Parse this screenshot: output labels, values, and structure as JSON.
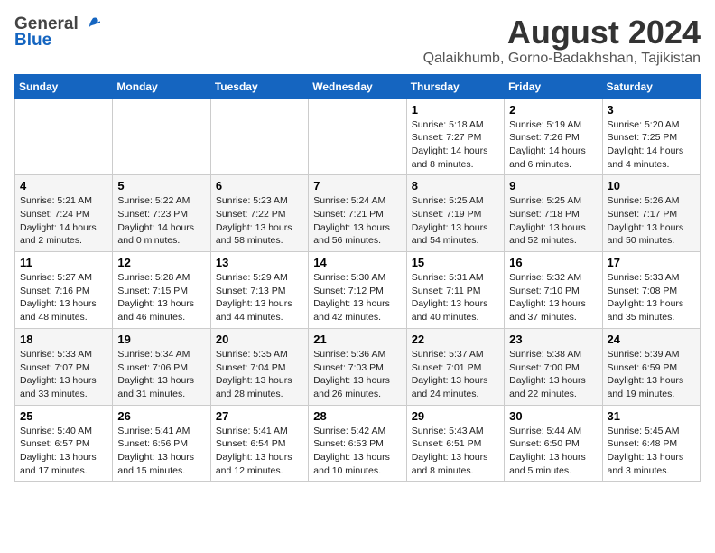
{
  "logo": {
    "general": "General",
    "blue": "Blue"
  },
  "title": "August 2024",
  "subtitle": "Qalaikhumb, Gorno-Badakhshan, Tajikistan",
  "days_of_week": [
    "Sunday",
    "Monday",
    "Tuesday",
    "Wednesday",
    "Thursday",
    "Friday",
    "Saturday"
  ],
  "weeks": [
    [
      {
        "day": "",
        "info": ""
      },
      {
        "day": "",
        "info": ""
      },
      {
        "day": "",
        "info": ""
      },
      {
        "day": "",
        "info": ""
      },
      {
        "day": "1",
        "info": "Sunrise: 5:18 AM\nSunset: 7:27 PM\nDaylight: 14 hours\nand 8 minutes."
      },
      {
        "day": "2",
        "info": "Sunrise: 5:19 AM\nSunset: 7:26 PM\nDaylight: 14 hours\nand 6 minutes."
      },
      {
        "day": "3",
        "info": "Sunrise: 5:20 AM\nSunset: 7:25 PM\nDaylight: 14 hours\nand 4 minutes."
      }
    ],
    [
      {
        "day": "4",
        "info": "Sunrise: 5:21 AM\nSunset: 7:24 PM\nDaylight: 14 hours\nand 2 minutes."
      },
      {
        "day": "5",
        "info": "Sunrise: 5:22 AM\nSunset: 7:23 PM\nDaylight: 14 hours\nand 0 minutes."
      },
      {
        "day": "6",
        "info": "Sunrise: 5:23 AM\nSunset: 7:22 PM\nDaylight: 13 hours\nand 58 minutes."
      },
      {
        "day": "7",
        "info": "Sunrise: 5:24 AM\nSunset: 7:21 PM\nDaylight: 13 hours\nand 56 minutes."
      },
      {
        "day": "8",
        "info": "Sunrise: 5:25 AM\nSunset: 7:19 PM\nDaylight: 13 hours\nand 54 minutes."
      },
      {
        "day": "9",
        "info": "Sunrise: 5:25 AM\nSunset: 7:18 PM\nDaylight: 13 hours\nand 52 minutes."
      },
      {
        "day": "10",
        "info": "Sunrise: 5:26 AM\nSunset: 7:17 PM\nDaylight: 13 hours\nand 50 minutes."
      }
    ],
    [
      {
        "day": "11",
        "info": "Sunrise: 5:27 AM\nSunset: 7:16 PM\nDaylight: 13 hours\nand 48 minutes."
      },
      {
        "day": "12",
        "info": "Sunrise: 5:28 AM\nSunset: 7:15 PM\nDaylight: 13 hours\nand 46 minutes."
      },
      {
        "day": "13",
        "info": "Sunrise: 5:29 AM\nSunset: 7:13 PM\nDaylight: 13 hours\nand 44 minutes."
      },
      {
        "day": "14",
        "info": "Sunrise: 5:30 AM\nSunset: 7:12 PM\nDaylight: 13 hours\nand 42 minutes."
      },
      {
        "day": "15",
        "info": "Sunrise: 5:31 AM\nSunset: 7:11 PM\nDaylight: 13 hours\nand 40 minutes."
      },
      {
        "day": "16",
        "info": "Sunrise: 5:32 AM\nSunset: 7:10 PM\nDaylight: 13 hours\nand 37 minutes."
      },
      {
        "day": "17",
        "info": "Sunrise: 5:33 AM\nSunset: 7:08 PM\nDaylight: 13 hours\nand 35 minutes."
      }
    ],
    [
      {
        "day": "18",
        "info": "Sunrise: 5:33 AM\nSunset: 7:07 PM\nDaylight: 13 hours\nand 33 minutes."
      },
      {
        "day": "19",
        "info": "Sunrise: 5:34 AM\nSunset: 7:06 PM\nDaylight: 13 hours\nand 31 minutes."
      },
      {
        "day": "20",
        "info": "Sunrise: 5:35 AM\nSunset: 7:04 PM\nDaylight: 13 hours\nand 28 minutes."
      },
      {
        "day": "21",
        "info": "Sunrise: 5:36 AM\nSunset: 7:03 PM\nDaylight: 13 hours\nand 26 minutes."
      },
      {
        "day": "22",
        "info": "Sunrise: 5:37 AM\nSunset: 7:01 PM\nDaylight: 13 hours\nand 24 minutes."
      },
      {
        "day": "23",
        "info": "Sunrise: 5:38 AM\nSunset: 7:00 PM\nDaylight: 13 hours\nand 22 minutes."
      },
      {
        "day": "24",
        "info": "Sunrise: 5:39 AM\nSunset: 6:59 PM\nDaylight: 13 hours\nand 19 minutes."
      }
    ],
    [
      {
        "day": "25",
        "info": "Sunrise: 5:40 AM\nSunset: 6:57 PM\nDaylight: 13 hours\nand 17 minutes."
      },
      {
        "day": "26",
        "info": "Sunrise: 5:41 AM\nSunset: 6:56 PM\nDaylight: 13 hours\nand 15 minutes."
      },
      {
        "day": "27",
        "info": "Sunrise: 5:41 AM\nSunset: 6:54 PM\nDaylight: 13 hours\nand 12 minutes."
      },
      {
        "day": "28",
        "info": "Sunrise: 5:42 AM\nSunset: 6:53 PM\nDaylight: 13 hours\nand 10 minutes."
      },
      {
        "day": "29",
        "info": "Sunrise: 5:43 AM\nSunset: 6:51 PM\nDaylight: 13 hours\nand 8 minutes."
      },
      {
        "day": "30",
        "info": "Sunrise: 5:44 AM\nSunset: 6:50 PM\nDaylight: 13 hours\nand 5 minutes."
      },
      {
        "day": "31",
        "info": "Sunrise: 5:45 AM\nSunset: 6:48 PM\nDaylight: 13 hours\nand 3 minutes."
      }
    ]
  ]
}
